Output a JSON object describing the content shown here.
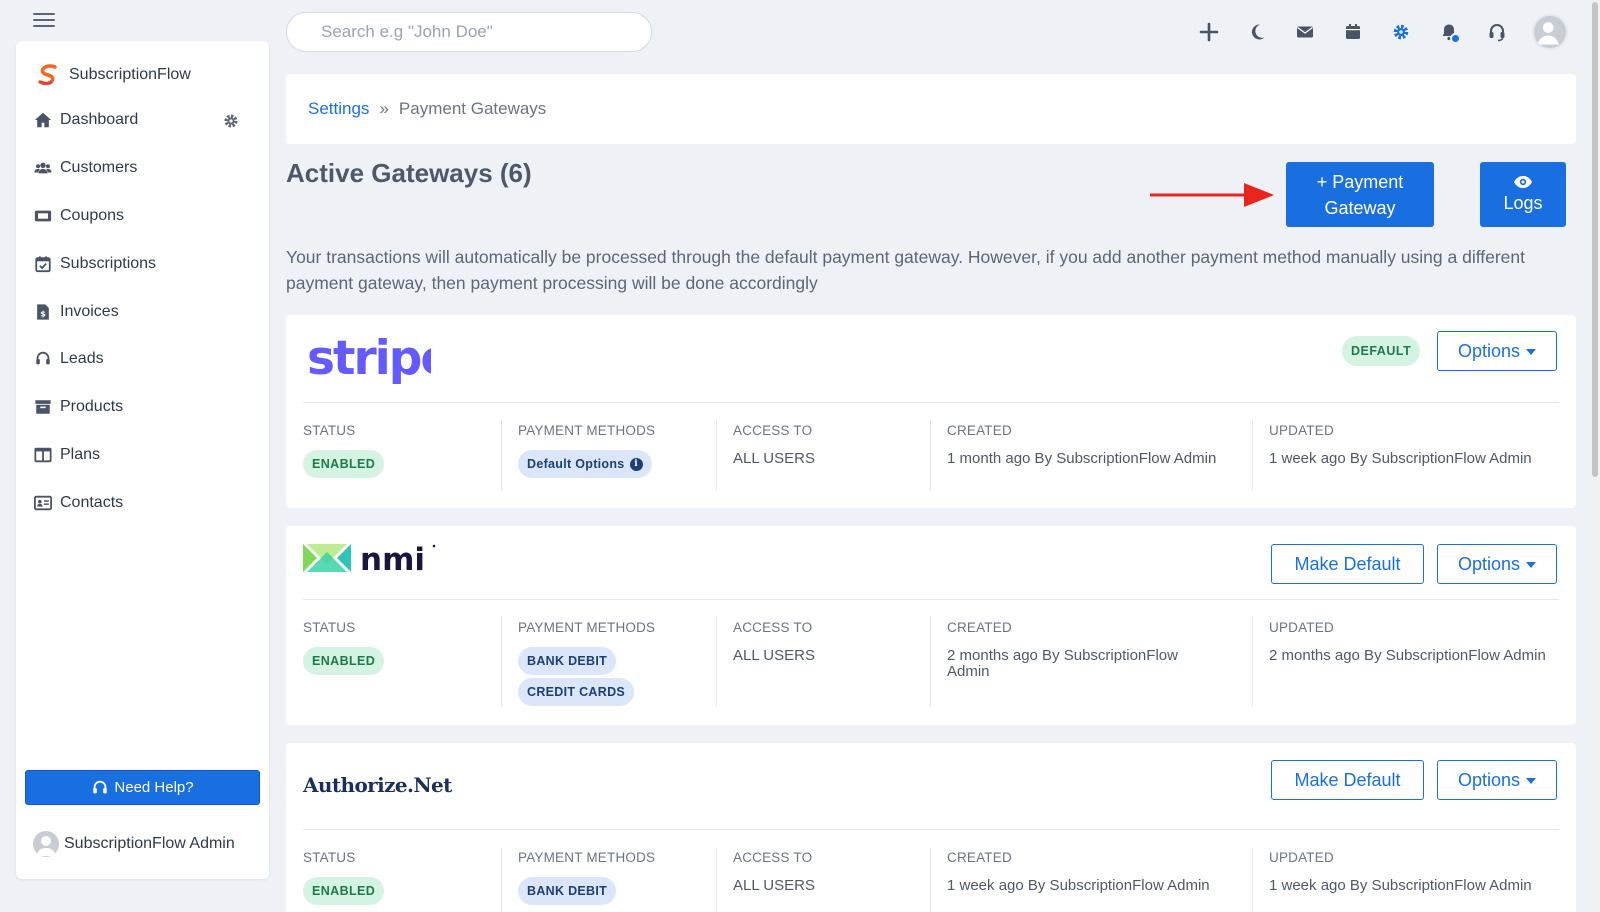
{
  "search": {
    "placeholder": "Search e.g \"John Doe\""
  },
  "topbar": {
    "icons": [
      "plus-icon",
      "moon-icon",
      "mail-icon",
      "calendar-icon",
      "gear-icon",
      "bell-icon",
      "headset-icon",
      "avatar"
    ]
  },
  "sidebar": {
    "brand": "SubscriptionFlow",
    "items": [
      {
        "label": "Dashboard",
        "icon": "home-icon"
      },
      {
        "label": "Customers",
        "icon": "users-icon"
      },
      {
        "label": "Coupons",
        "icon": "ticket-icon"
      },
      {
        "label": "Subscriptions",
        "icon": "calendar-check-icon"
      },
      {
        "label": "Invoices",
        "icon": "invoice-icon"
      },
      {
        "label": "Leads",
        "icon": "headset-icon"
      },
      {
        "label": "Products",
        "icon": "archive-icon"
      },
      {
        "label": "Plans",
        "icon": "columns-icon"
      },
      {
        "label": "Contacts",
        "icon": "address-card-icon"
      }
    ],
    "help_label": "Need Help?",
    "user_name": "SubscriptionFlow Admin"
  },
  "breadcrumb": {
    "root": "Settings",
    "separator": "»",
    "current": "Payment Gateways"
  },
  "page": {
    "title": "Active Gateways (6)",
    "add_gateway_line1": "+ Payment",
    "add_gateway_line2": "Gateway",
    "logs_label": "Logs",
    "description": "Your transactions will automatically be processed through the default payment gateway. However, if you add another payment method manually using a different payment gateway, then payment processing will be done accordingly"
  },
  "columns": {
    "status": "STATUS",
    "payment_methods": "PAYMENT METHODS",
    "access_to": "ACCESS TO",
    "created": "CREATED",
    "updated": "UPDATED"
  },
  "gateways": [
    {
      "name": "stripe",
      "default_badge": "DEFAULT",
      "options_label": "Options",
      "status": "ENABLED",
      "payment_methods": [
        "Default Options"
      ],
      "access_to": "ALL USERS",
      "created": "1 month ago By SubscriptionFlow Admin",
      "updated": "1 week ago By SubscriptionFlow Admin"
    },
    {
      "name": "nmi",
      "make_default_label": "Make Default",
      "options_label": "Options",
      "status": "ENABLED",
      "payment_methods": [
        "BANK DEBIT",
        "CREDIT CARDS"
      ],
      "access_to": "ALL USERS",
      "created": "2 months ago By SubscriptionFlow Admin",
      "updated": "2 months ago By SubscriptionFlow Admin"
    },
    {
      "name": "Authorize.Net",
      "make_default_label": "Make Default",
      "options_label": "Options",
      "status": "ENABLED",
      "payment_methods": [
        "BANK DEBIT"
      ],
      "access_to": "ALL USERS",
      "created": "1 week ago By SubscriptionFlow Admin",
      "updated": "1 week ago By SubscriptionFlow Admin"
    }
  ],
  "colors": {
    "primary": "#1a6fe0",
    "background": "#eef2f7",
    "stripe_brand": "#635bff",
    "nmi_brand": "#1d1340",
    "authorize_brand": "#1b2f5b"
  }
}
